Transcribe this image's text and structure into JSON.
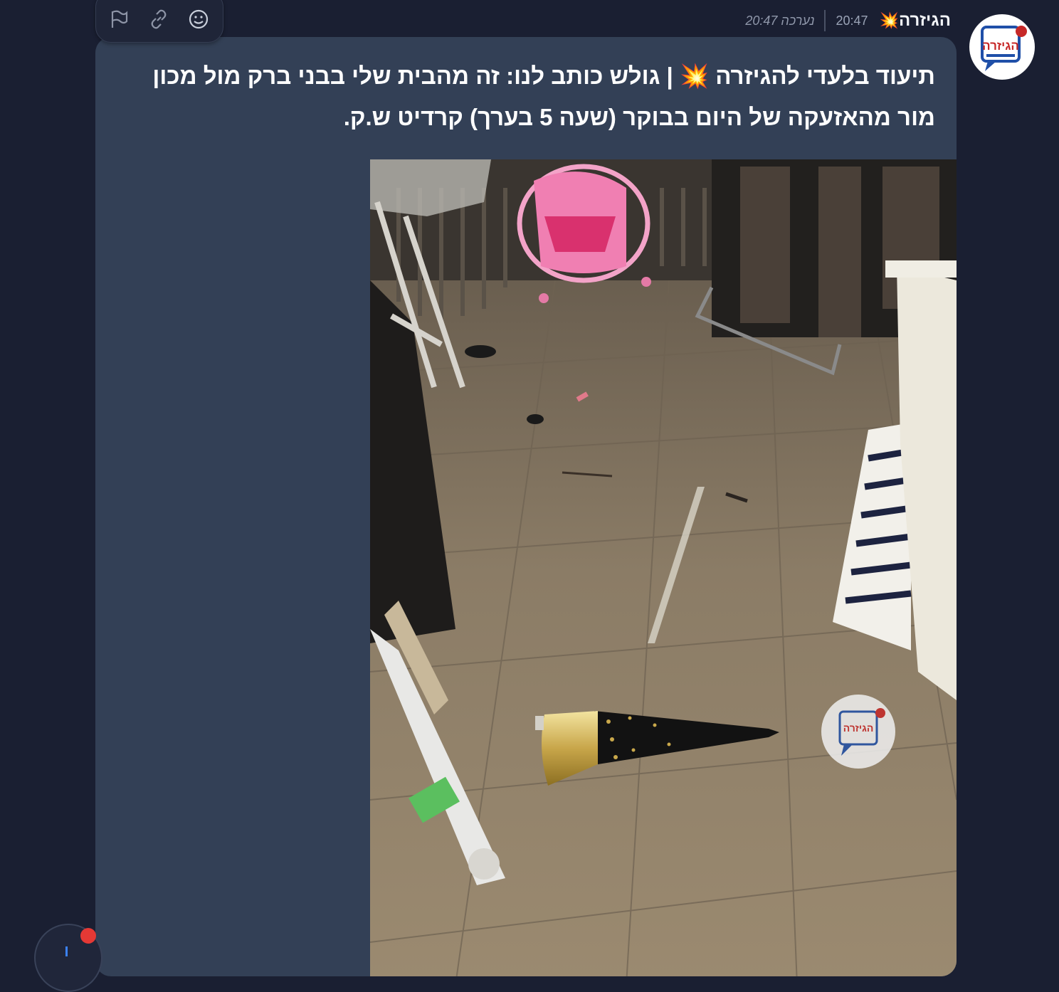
{
  "channel": {
    "name": "הגיזרה",
    "emoji": "💥",
    "avatar_icon": "hagizra-logo-icon",
    "avatar_text": "הגיזרה"
  },
  "message": {
    "time": "20:47",
    "edited_label": "נערכה 20:47",
    "text": "תיעוד בלעדי להגיזרה 💥 | גולש כותב לנו: זה מהבית שלי בבני ברק מול מכון מור מהאזעקה של היום בבוקר (שעה 5 בערך) קרדיט ש.ק.",
    "image": {
      "description_icon": "photo-missile-fragment",
      "watermark_icon": "hagizra-watermark-icon",
      "watermark_text": "הגיזרה"
    }
  },
  "toolbar": {
    "icons": [
      "react-smiley-icon",
      "copy-link-icon",
      "report-flag-icon"
    ]
  },
  "colors": {
    "background": "#1a1f32",
    "bubble": "#334056",
    "text": "#ffffff",
    "meta": "#9aa3b6",
    "notification_dot": "#e53935"
  }
}
